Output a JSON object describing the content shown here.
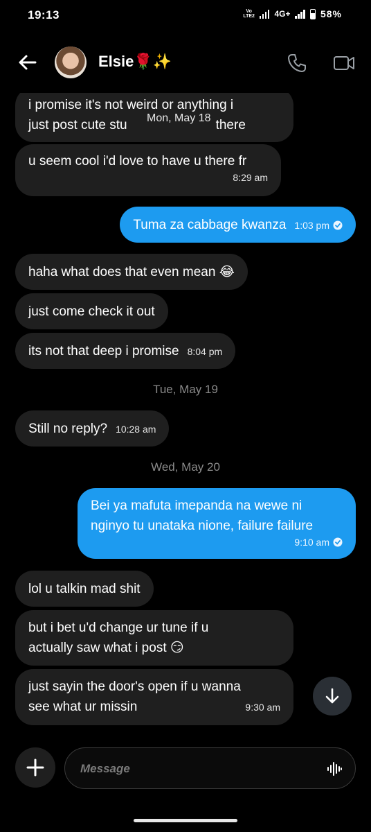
{
  "status_bar": {
    "time": "19:13",
    "volte": "VoLTE2",
    "network": "4G+",
    "battery": "58%",
    "battery_level": 0.58
  },
  "header": {
    "contact_name": "Elsie",
    "name_emoji": "🌹✨"
  },
  "floating_date": "Mon, May 18",
  "messages": [
    {
      "text": "i promise it's not weird or anything i just post cute stuff... Come lol there",
      "visible_line1": "i promise it's not weird or anything i",
      "visible_line2_a": "just post cute stu",
      "visible_line2_b": "there",
      "time": ""
    },
    {
      "text": "u seem cool i'd love to have u there fr",
      "time": "8:29 am"
    },
    {
      "text": "Tuma za cabbage kwanza",
      "time": "1:03 pm"
    },
    {
      "text": "haha what does that even mean 😂",
      "time": ""
    },
    {
      "text": "just come check it out",
      "time": ""
    },
    {
      "text": "its not that deep i promise",
      "time": "8:04 pm"
    },
    {
      "text": "Still no reply?",
      "time": "10:28 am"
    },
    {
      "text": "Bei ya mafuta imepanda na wewe ni nginyo tu unataka nione, failure failure",
      "line1": "Bei ya mafuta imepanda na wewe ni",
      "line2": "nginyo tu unataka nione, failure failure",
      "time": "9:10 am"
    },
    {
      "text": "lol u talkin mad shit",
      "time": ""
    },
    {
      "text": "but i bet u'd change ur tune if u actually saw what i post 😏",
      "line1": "but i bet u'd change ur tune if u",
      "line2": "actually saw what i post 😏",
      "time": ""
    },
    {
      "text": "just sayin the door's open if u wanna see what ur missin",
      "line1": "just sayin the door's open if u wanna",
      "line2": "see what ur missin",
      "time": "9:30 am"
    }
  ],
  "dates": {
    "tue": "Tue, May 19",
    "wed": "Wed, May 20"
  },
  "composer": {
    "placeholder": "Message"
  },
  "icons": [
    "back-arrow-icon",
    "phone-icon",
    "video-camera-icon",
    "read-check-icon",
    "arrow-down-icon",
    "plus-icon",
    "voice-wave-icon"
  ],
  "colors": {
    "sent_bubble": "#1d9bf0",
    "received_bubble": "#1f1f1f",
    "background": "#000000"
  }
}
